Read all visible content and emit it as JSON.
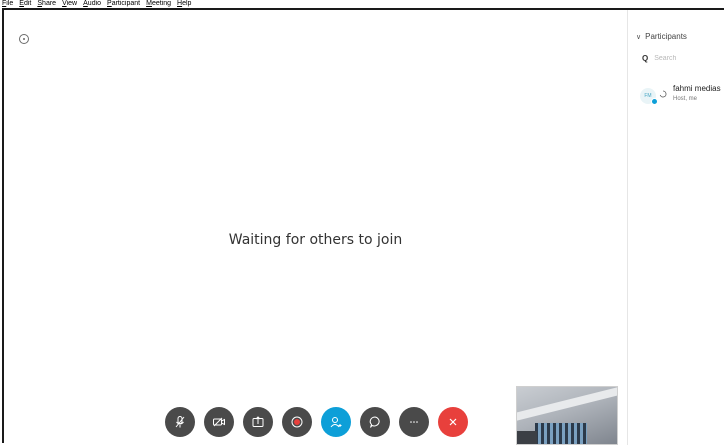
{
  "menubar": {
    "items": [
      {
        "label": "File",
        "mnemonic": "F",
        "rest": "ile"
      },
      {
        "label": "Edit",
        "mnemonic": "E",
        "rest": "dit"
      },
      {
        "label": "Share",
        "mnemonic": "S",
        "rest": "hare"
      },
      {
        "label": "View",
        "mnemonic": "V",
        "rest": "iew"
      },
      {
        "label": "Audio",
        "mnemonic": "A",
        "rest": "udio"
      },
      {
        "label": "Participant",
        "mnemonic": "P",
        "rest": "articipant"
      },
      {
        "label": "Meeting",
        "mnemonic": "M",
        "rest": "eeting"
      },
      {
        "label": "Help",
        "mnemonic": "H",
        "rest": "elp"
      }
    ]
  },
  "stage": {
    "waiting_text": "Waiting for others to join"
  },
  "controls": [
    {
      "name": "mute-button",
      "icon": "microphone-muted-icon"
    },
    {
      "name": "video-button",
      "icon": "video-off-icon"
    },
    {
      "name": "share-button",
      "icon": "share-icon"
    },
    {
      "name": "record-button",
      "icon": "record-icon"
    },
    {
      "name": "participants-button",
      "icon": "participants-icon"
    },
    {
      "name": "chat-button",
      "icon": "chat-icon"
    },
    {
      "name": "more-button",
      "icon": "more-icon"
    },
    {
      "name": "leave-button",
      "icon": "close-icon"
    }
  ],
  "panel": {
    "title": "Participants",
    "search_placeholder": "Search",
    "participants": [
      {
        "initials": "FM",
        "name": "fahmi medias",
        "role": "Host, me"
      }
    ]
  },
  "colors": {
    "accent": "#0d9fd8",
    "leave": "#e8403c",
    "control_bg": "#4a4a4a"
  }
}
